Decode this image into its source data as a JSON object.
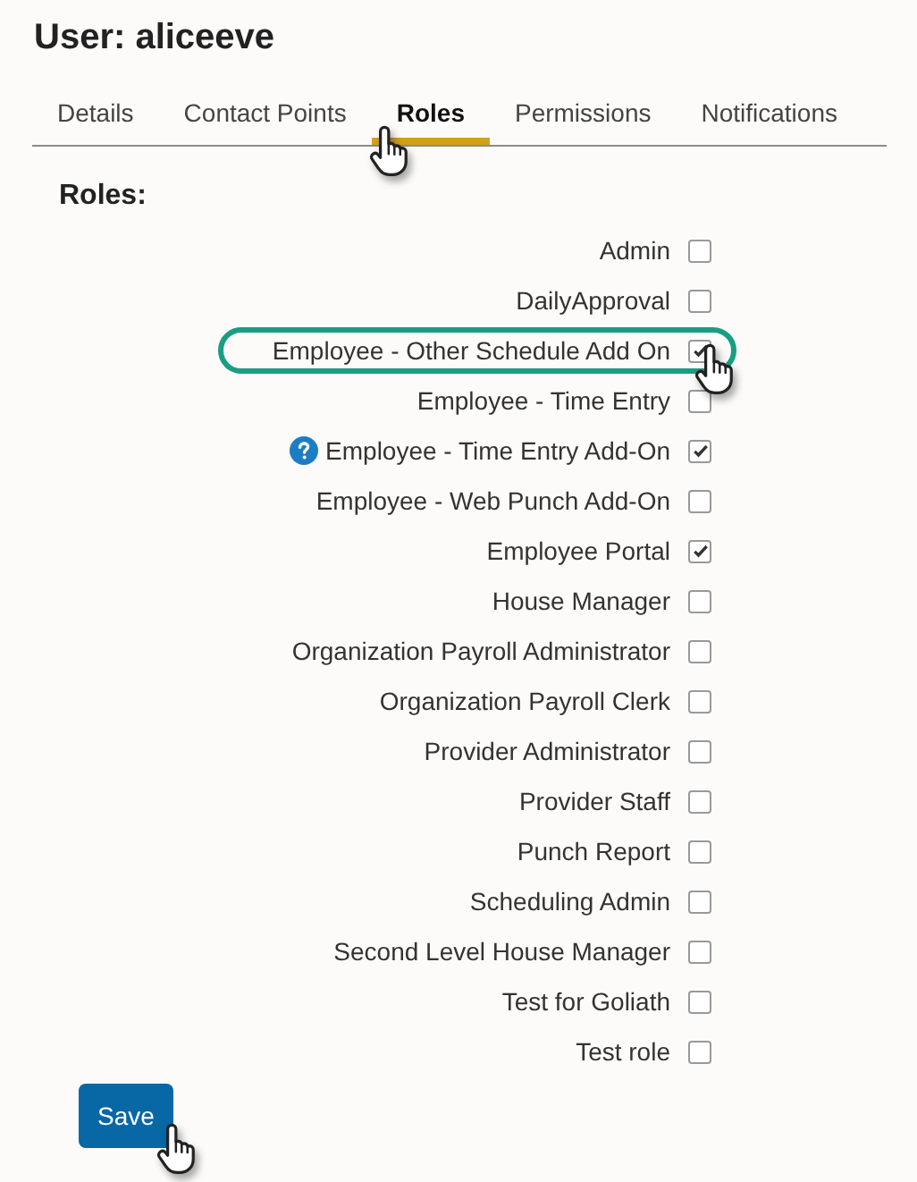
{
  "title": "User: aliceeve",
  "tabs": [
    {
      "label": "Details",
      "selected": false
    },
    {
      "label": "Contact Points",
      "selected": false
    },
    {
      "label": "Roles",
      "selected": true
    },
    {
      "label": "Permissions",
      "selected": false
    },
    {
      "label": "Notifications",
      "selected": false
    }
  ],
  "section_heading": "Roles:",
  "roles": [
    {
      "label": "Admin",
      "checked": false,
      "highlighted": false,
      "help": false
    },
    {
      "label": "DailyApproval",
      "checked": false,
      "highlighted": false,
      "help": false
    },
    {
      "label": "Employee - Other Schedule Add On",
      "checked": true,
      "highlighted": true,
      "help": false
    },
    {
      "label": "Employee - Time Entry",
      "checked": false,
      "highlighted": false,
      "help": false
    },
    {
      "label": "Employee - Time Entry Add-On",
      "checked": true,
      "highlighted": false,
      "help": true
    },
    {
      "label": "Employee - Web Punch Add-On",
      "checked": false,
      "highlighted": false,
      "help": false
    },
    {
      "label": "Employee Portal",
      "checked": true,
      "highlighted": false,
      "help": false
    },
    {
      "label": "House Manager",
      "checked": false,
      "highlighted": false,
      "help": false
    },
    {
      "label": "Organization Payroll Administrator",
      "checked": false,
      "highlighted": false,
      "help": false
    },
    {
      "label": "Organization Payroll Clerk",
      "checked": false,
      "highlighted": false,
      "help": false
    },
    {
      "label": "Provider Administrator",
      "checked": false,
      "highlighted": false,
      "help": false
    },
    {
      "label": "Provider Staff",
      "checked": false,
      "highlighted": false,
      "help": false
    },
    {
      "label": "Punch Report",
      "checked": false,
      "highlighted": false,
      "help": false
    },
    {
      "label": "Scheduling Admin",
      "checked": false,
      "highlighted": false,
      "help": false
    },
    {
      "label": "Second Level House Manager",
      "checked": false,
      "highlighted": false,
      "help": false
    },
    {
      "label": "Test for Goliath",
      "checked": false,
      "highlighted": false,
      "help": false
    },
    {
      "label": "Test role",
      "checked": false,
      "highlighted": false,
      "help": false
    }
  ],
  "save_button": "Save"
}
